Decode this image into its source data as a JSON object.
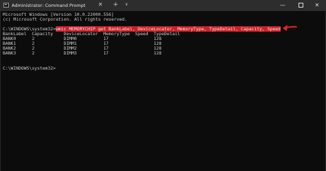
{
  "titlebar": {
    "title": "Administrator: Command Prompt",
    "tab_close_glyph": "✕",
    "new_tab_glyph": "+",
    "dropdown_glyph": "∨",
    "minimize_glyph": "—",
    "close_glyph": "✕"
  },
  "console": {
    "header_line1": "Microsoft Windows [Version 10.0.22000.556]",
    "header_line2": "(c) Microsoft Corporation. All rights reserved.",
    "prompt_prefix": "C:\\WINDOWS\\system32>",
    "command": "wmic MEMORYCHIP get BankLabel, DeviceLocator, MemoryType, TypeDetail, Capacity, Speed",
    "table_header": "BankLabel  Capacity    DeviceLocator  MemoryType  Speed  TypeDetail",
    "rows": [
      "BANK0      2           DIMM0          17                 128",
      "BANK1      2           DIMM1          17                 128",
      "BANK2      2           DIMM2          17                 128",
      "BANK3      2           DIMM3          17                 128"
    ],
    "final_prompt": "C:\\WINDOWS\\system32>"
  },
  "colors": {
    "background": "#0c0c0c",
    "text": "#cccccc",
    "highlight": "#c9212a",
    "arrow": "#e8202a",
    "titlebar": "#2d2d2d"
  }
}
